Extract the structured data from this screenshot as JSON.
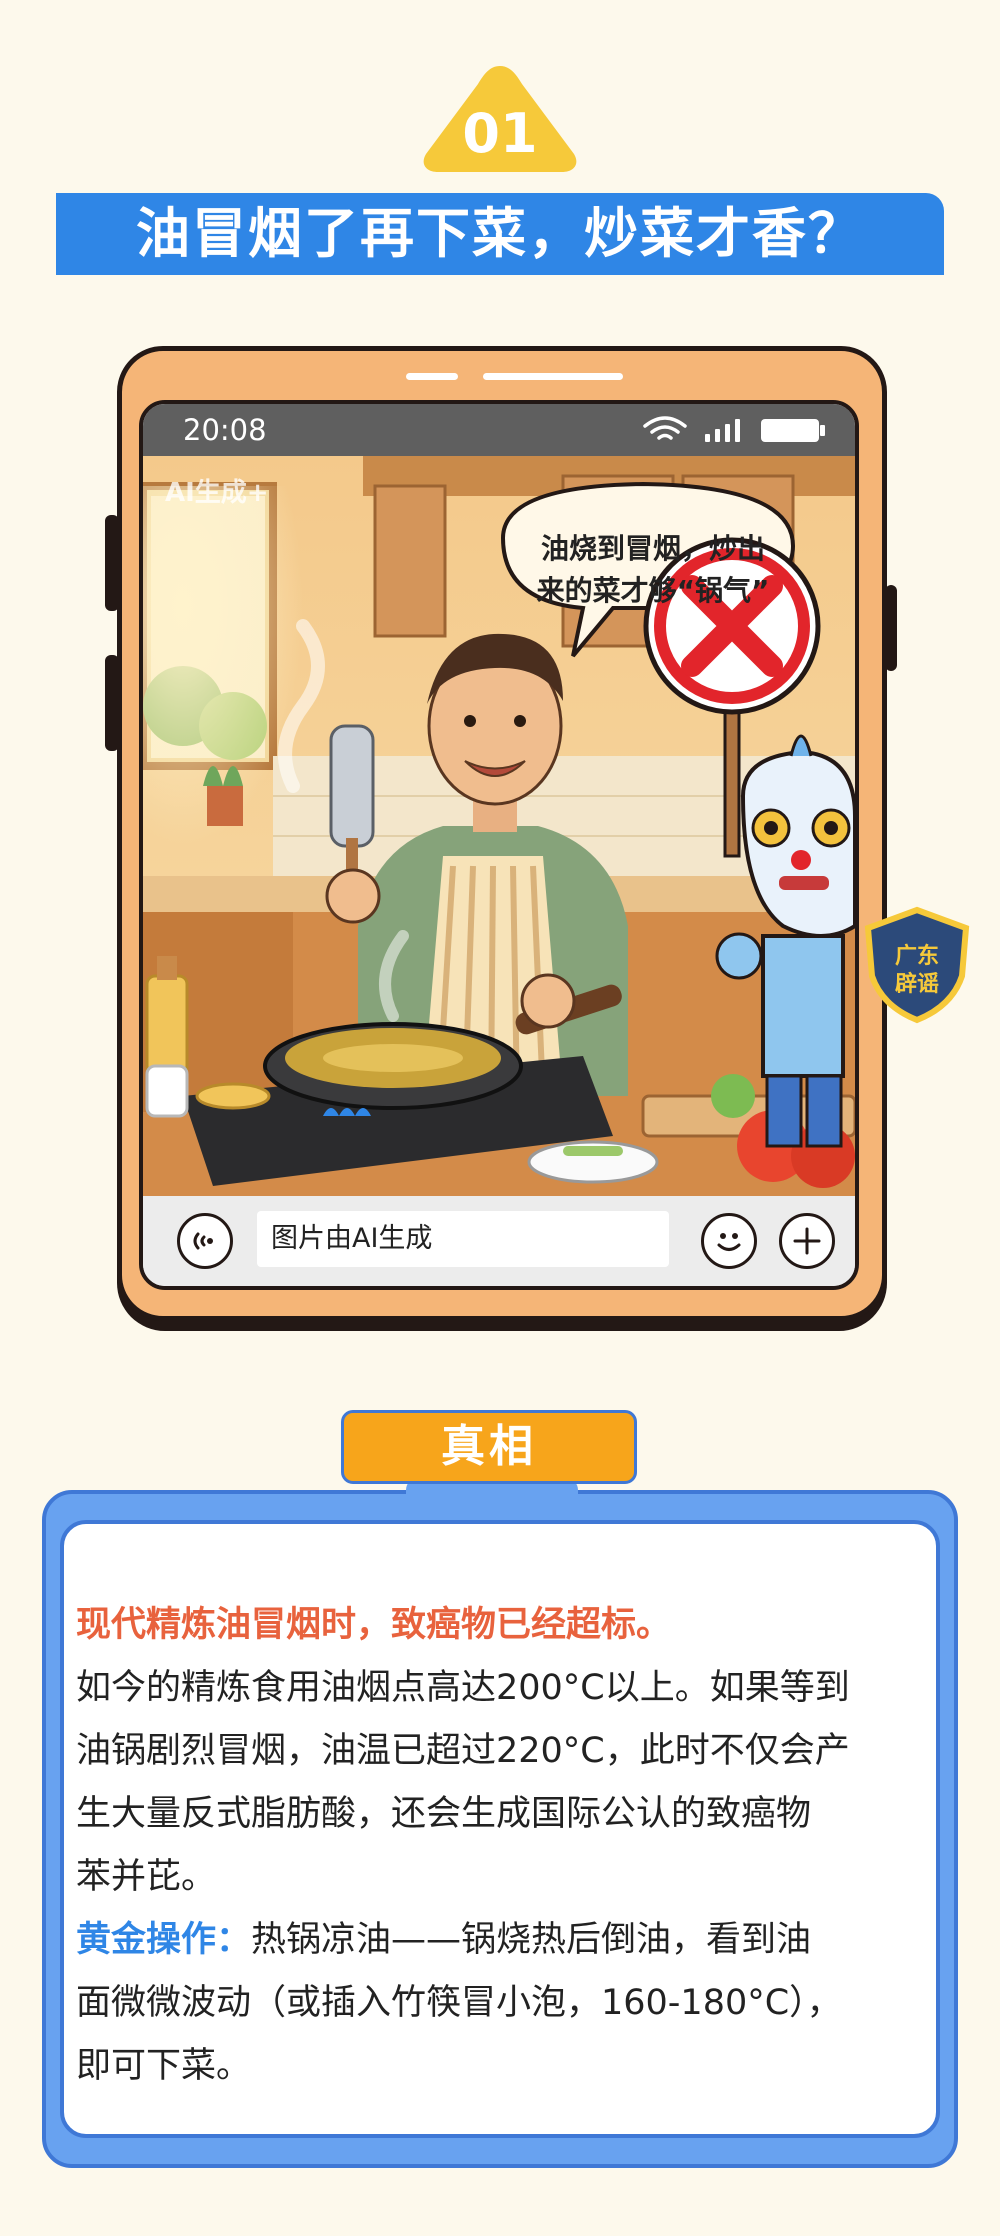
{
  "header": {
    "number": "01",
    "title": "油冒烟了再下菜，炒菜才香？"
  },
  "phone": {
    "time": "20:08",
    "watermark": "AI生成+",
    "speech_bubble": [
      "油烧到冒烟，炒出",
      "来的菜才够“锅气”"
    ],
    "mascot_badge": [
      "广东",
      "辟谣"
    ],
    "input_placeholder": "图片由AI生成",
    "icons": [
      "wifi-icon",
      "signal-icon",
      "battery-icon",
      "voice-icon",
      "emoji-icon",
      "plus-icon",
      "cross-sign-icon"
    ]
  },
  "truth": {
    "tab_label": "真相",
    "headline": "现代精炼油冒烟时，致癌物已经超标。",
    "paragraph_lines": [
      "如今的精炼食用油烟点高达200°C以上。如果等到",
      "油锅剧烈冒烟，油温已超过220°C，此时不仅会产",
      "生大量反式脂肪酸，还会生成国际公认的致癌物",
      "苯并芘。"
    ],
    "tip_label": "黄金操作：",
    "tip_lines": [
      "热锅凉油——锅烧热后倒油，看到油",
      "面微微波动（或插入竹筷冒小泡，160-180°C），",
      "即可下菜。"
    ]
  },
  "colors": {
    "background": "#fdf9ec",
    "title_bar": "#2f86e6",
    "badge": "#f6c93a",
    "phone_body": "#f5b577",
    "truth_tab": "#f7a51b",
    "headline": "#e8623d",
    "tip_label": "#2f86e6"
  }
}
